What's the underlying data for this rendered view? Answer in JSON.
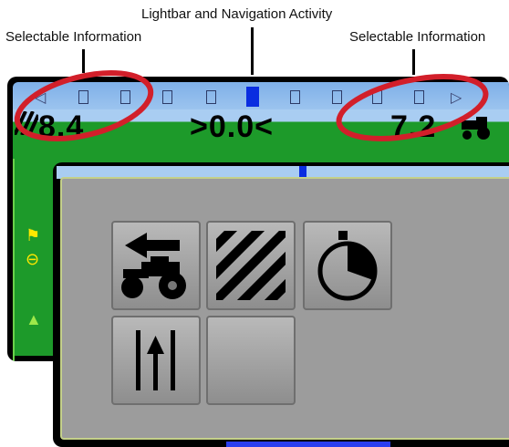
{
  "annotations": {
    "top_center": "Lightbar and Navigation Activity",
    "left": "Selectable Information",
    "right": "Selectable Information"
  },
  "back_screen": {
    "readout_left": "8.4",
    "readout_center": ">0.0<",
    "readout_right": "7.2",
    "lightbar_active_index": 5,
    "lightbar_cells": 10
  },
  "menu": {
    "tiles": [
      {
        "icon": "tractor-reverse-icon",
        "label": ""
      },
      {
        "icon": "hatch-pattern-icon",
        "label": ""
      },
      {
        "icon": "timer-icon",
        "label": ""
      },
      {
        "icon": "guideline-icon",
        "label": ""
      },
      {
        "icon": "empty-tile",
        "label": ""
      }
    ]
  },
  "colors": {
    "highlight_ellipse": "#d21f2a",
    "lightbar_active": "#0a2de0",
    "field_green": "#1d9a2a",
    "sky_blue": "#a9cdf2",
    "panel_gray": "#9c9c9c"
  }
}
